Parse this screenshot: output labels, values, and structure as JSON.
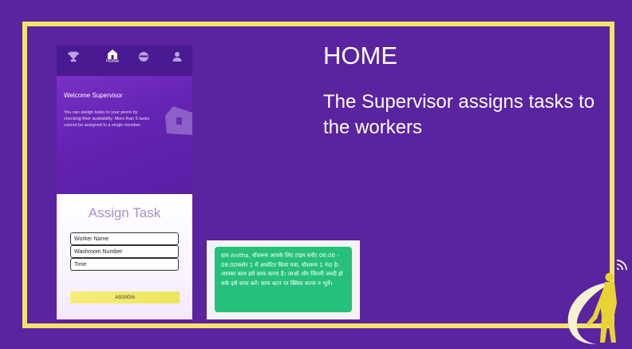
{
  "slide": {
    "title": "HOME",
    "description": "The Supervisor assigns tasks to the workers"
  },
  "phone": {
    "nav": {
      "items": [
        {
          "icon": "trophy-icon"
        },
        {
          "icon": "home-icon",
          "label": "Home"
        },
        {
          "icon": "face-icon"
        },
        {
          "icon": "person-icon"
        }
      ]
    },
    "hero": {
      "title": "Welcome Supervisor",
      "text": "You can assign tasks to your peers by checking their availability. More than 5 tasks cannot be assigned to a single member."
    },
    "form": {
      "title": "Assign Task",
      "worker_placeholder": "Worker Name",
      "washroom_placeholder": "Washroom Number",
      "time_placeholder": "Time",
      "button_label": "ASSIGN"
    }
  },
  "message": {
    "text": "हाय Anitha, वॉशरूम आपके लिए टाइम स्लॉट 06:00 - 08:00फ्लोर 1 में आवंटित किया गया, वॉशरूम 1 गंदा है। आपका काम इसे साफ करना है। जाओ और जितनी जल्दी हो सके इसे साफ करें। साफ बटन पर क्लिक करना न भूलें।"
  },
  "colors": {
    "background": "#5a23a0",
    "frame": "#f4e26a",
    "message_bubble": "#25c07a",
    "assign_button": "#f3ee7a"
  }
}
